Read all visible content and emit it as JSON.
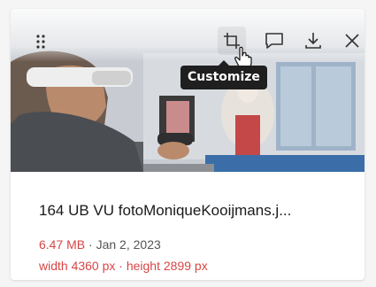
{
  "card": {
    "toolbar": {
      "drag_handle": "drag-handle-icon",
      "buttons": [
        {
          "icon": "crop-icon",
          "name": "crop-button"
        },
        {
          "icon": "comment-icon",
          "name": "comment-button"
        },
        {
          "icon": "download-icon",
          "name": "download-button"
        },
        {
          "icon": "close-icon",
          "name": "close-button"
        }
      ]
    },
    "tooltip": "Customize",
    "filename": "164 UB VU fotoMoniqueKooijmans.j...",
    "file_size": "6.47 MB",
    "separator": " · ",
    "date": "Jan 2, 2023",
    "dimensions": "width 4360 px · height 2899 px",
    "colors": {
      "accent_red": "#d84545",
      "text_dark": "#1a1a1a",
      "tooltip_bg": "#1f1f1f"
    }
  }
}
